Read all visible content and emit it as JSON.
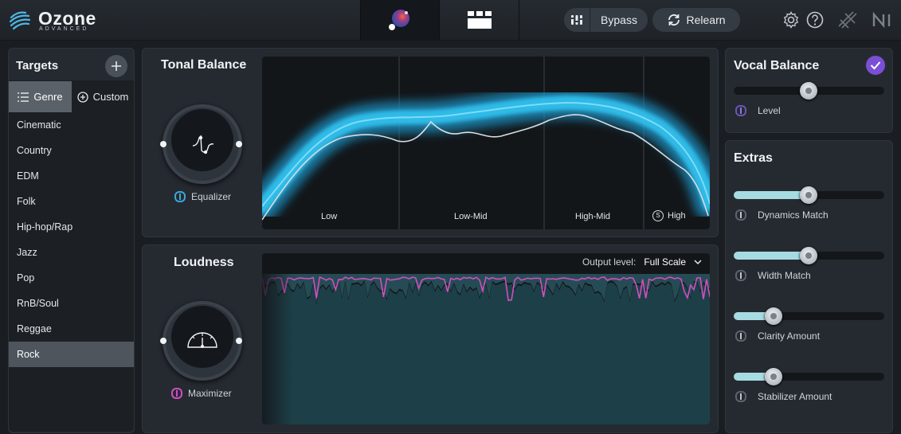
{
  "app": {
    "name": "Ozone",
    "edition": "ADVANCED",
    "accent": "#39b6e8",
    "magenta": "#d04fc0"
  },
  "topbar": {
    "assistant_icon": "assistant-orb-icon",
    "modules_icon": "modules-grid-icon",
    "bypass_label": "Bypass",
    "relearn_label": "Relearn",
    "icons": [
      "settings-gear-icon",
      "help-icon",
      "codec-preview-icon",
      "ni-logo-icon"
    ]
  },
  "targets": {
    "title": "Targets",
    "tabs": {
      "genre": "Genre",
      "custom": "Custom"
    },
    "genres": [
      "Cinematic",
      "Country",
      "EDM",
      "Folk",
      "Hip-hop/Rap",
      "Jazz",
      "Pop",
      "RnB/Soul",
      "Reggae",
      "Rock"
    ],
    "selected": "Rock"
  },
  "tonal_balance": {
    "title": "Tonal Balance",
    "knob_label": "Equalizer",
    "bands": [
      "Low",
      "Low-Mid",
      "High-Mid",
      "High"
    ],
    "solo_badge": "S"
  },
  "loudness": {
    "title": "Loudness",
    "knob_label": "Maximizer",
    "output_level_label": "Output level:",
    "output_level_value": "Full Scale"
  },
  "vocal_balance": {
    "title": "Vocal Balance",
    "enabled": true,
    "level_label": "Level",
    "level_value": 0.5
  },
  "extras": {
    "title": "Extras",
    "sliders": [
      {
        "label": "Dynamics Match",
        "value": 0.5
      },
      {
        "label": "Width Match",
        "value": 0.5
      },
      {
        "label": "Clarity Amount",
        "value": 0.27
      },
      {
        "label": "Stabilizer Amount",
        "value": 0.27
      }
    ]
  }
}
